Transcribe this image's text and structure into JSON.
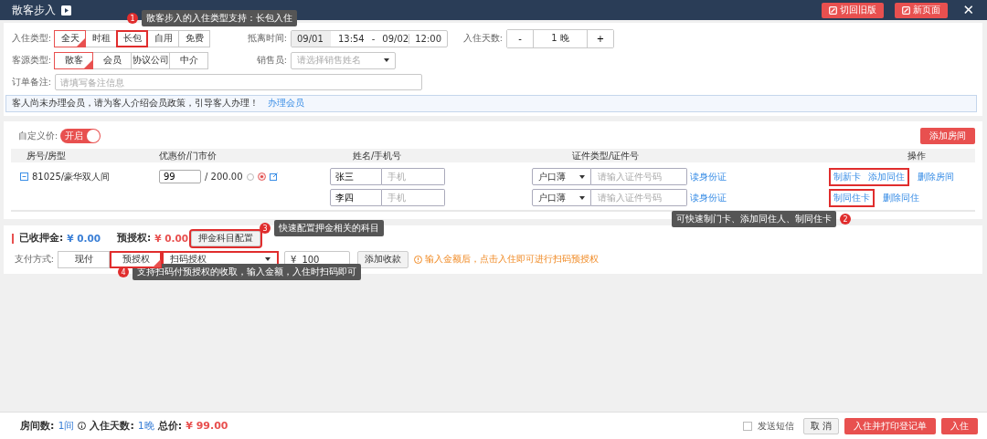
{
  "window": {
    "title": "散客步入",
    "buttons": [
      {
        "label": "切回旧版"
      },
      {
        "label": "新页面"
      }
    ],
    "close": "✕"
  },
  "form": {
    "stay_type": {
      "label": "入住类型:",
      "options": [
        {
          "label": "全天",
          "selected": true,
          "highlighted": false
        },
        {
          "label": "时租",
          "selected": false,
          "highlighted": false
        },
        {
          "label": "长包",
          "selected": false,
          "highlighted": true
        },
        {
          "label": "自用",
          "selected": false,
          "highlighted": false
        },
        {
          "label": "免费",
          "selected": false,
          "highlighted": false
        }
      ]
    },
    "time": {
      "label": "抵离时间:",
      "start_date": "09/01",
      "start_time": "13:54",
      "separator": "-",
      "end_date": "09/02",
      "end_time": "12:00"
    },
    "days": {
      "label": "入住天数:",
      "minus": "-",
      "value": "1 晚",
      "plus": "+"
    },
    "source_type": {
      "label": "客源类型:",
      "options": [
        {
          "label": "散客",
          "selected": true,
          "highlighted": false
        },
        {
          "label": "会员",
          "selected": false,
          "highlighted": false
        },
        {
          "label": "协议公司",
          "selected": false,
          "highlighted": false
        },
        {
          "label": "中介",
          "selected": false,
          "highlighted": false
        }
      ]
    },
    "sales": {
      "label": "销售员:",
      "placeholder": "请选择销售姓名"
    },
    "remark": {
      "label": "订单备注:",
      "placeholder": "请填写备注信息"
    }
  },
  "notice": {
    "text": "客人尚未办理会员，请为客人介绍会员政策，引导客人办理！",
    "link": "办理会员"
  },
  "rooms": {
    "custom_price": {
      "label": "自定义价:",
      "on": true,
      "text": "开启"
    },
    "add_button": "添加房间",
    "columns": [
      "房号/房型",
      "优惠价/门市价",
      "姓名/手机号",
      "证件类型/证件号",
      "操作"
    ],
    "rows": [
      {
        "room": "81025/豪华双人间",
        "price": "99",
        "list_price": "/ 200.00",
        "guests": [
          {
            "name": "张三",
            "phone_placeholder": "手机",
            "id_type": "户口薄",
            "id_placeholder": "请输入证件号码",
            "read_link": "读身份证",
            "action_groups": [
              {
                "highlighted": true,
                "items": [
                  "制新卡",
                  "添加同住"
                ]
              },
              {
                "highlighted": false,
                "items": [
                  "删除房间"
                ]
              }
            ]
          },
          {
            "name": "李四",
            "phone_placeholder": "手机",
            "id_type": "户口薄",
            "id_placeholder": "请输入证件号码",
            "read_link": "读身份证",
            "action_groups": [
              {
                "highlighted": true,
                "items": [
                  "制同住卡"
                ]
              },
              {
                "highlighted": false,
                "items": [
                  "删除同住"
                ]
              }
            ]
          }
        ]
      }
    ]
  },
  "deposit": {
    "received_label": "已收押金:",
    "received_value": "¥ 0.00",
    "preauth_label": "预授权:",
    "preauth_value": "¥ 0.00",
    "config_button": {
      "label": "押金科目配置",
      "highlighted": true
    },
    "payment": {
      "label": "支付方式:",
      "methods": [
        {
          "label": "现付",
          "selected": false,
          "highlighted": false
        },
        {
          "label": "预授权",
          "selected": true,
          "highlighted": true
        }
      ],
      "scan_select": {
        "value": "扫码授权",
        "highlighted": true
      },
      "currency": "¥",
      "amount": "100",
      "add_button": "添加收款",
      "hint": "输入金额后，点击入住即可进行扫码预授权"
    }
  },
  "callouts": [
    {
      "number": "1",
      "text": "散客步入的入住类型支持：长包入住"
    },
    {
      "number": "2",
      "text": "可快速制门卡、添加同住人、制同住卡"
    },
    {
      "number": "3",
      "text": "快速配置押金相关的科目"
    },
    {
      "number": "4",
      "text": "支持扫码付预授权的收取，输入金额，入住时扫码即可"
    }
  ],
  "footer": {
    "rooms_label": "房间数:",
    "rooms_value": "1间",
    "days_label": "入住天数:",
    "days_value": "1晚",
    "total_label": "总价:",
    "total_value": "¥ 99.00",
    "sms": {
      "label": "发送短信",
      "checked": false
    },
    "cancel": "取 消",
    "print_button": "入住并打印登记单",
    "checkin": "入住"
  }
}
